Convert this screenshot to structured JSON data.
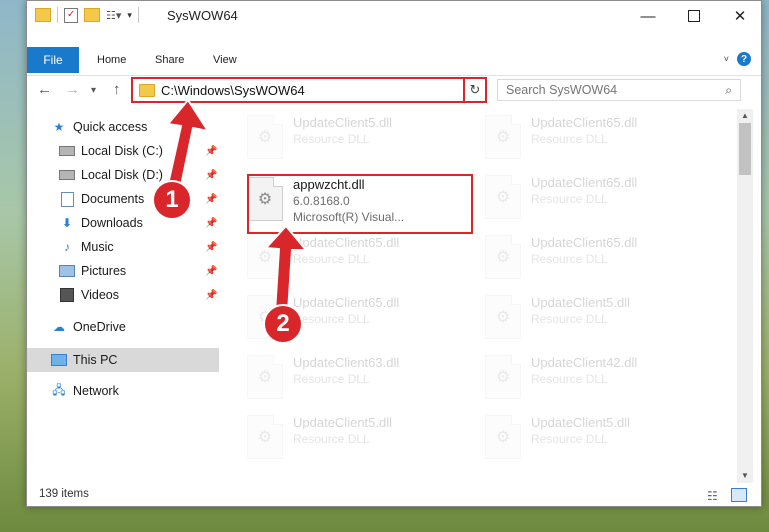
{
  "window": {
    "title": "SysWOW64"
  },
  "ribbon": {
    "file": "File",
    "home": "Home",
    "share": "Share",
    "view": "View"
  },
  "address": {
    "path": "C:\\Windows\\SysWOW64"
  },
  "search": {
    "placeholder": "Search SysWOW64"
  },
  "sidebar": {
    "items": [
      {
        "label": "Quick access"
      },
      {
        "label": "Local Disk (C:)"
      },
      {
        "label": "Local Disk (D:)"
      },
      {
        "label": "Documents"
      },
      {
        "label": "Downloads"
      },
      {
        "label": "Music"
      },
      {
        "label": "Pictures"
      },
      {
        "label": "Videos"
      },
      {
        "label": "OneDrive"
      },
      {
        "label": "This PC"
      },
      {
        "label": "Network"
      }
    ]
  },
  "files": [
    {
      "name": "UpdateClient5.dll",
      "desc": "Resource DLL"
    },
    {
      "name": "UpdateClient65.dll",
      "desc": "Resource DLL"
    },
    {
      "name": "appwzcht.dll",
      "version": "6.0.8168.0",
      "desc": "Microsoft(R) Visual..."
    },
    {
      "name": "UpdateClient65.dll",
      "desc": "Resource DLL"
    },
    {
      "name": "UpdateClient65.dll",
      "desc": "Resource DLL"
    },
    {
      "name": "UpdateClient65.dll",
      "desc": "Resource DLL"
    },
    {
      "name": "UpdateClient65.dll",
      "desc": "Resource DLL"
    },
    {
      "name": "UpdateClient5.dll",
      "desc": "Resource DLL"
    },
    {
      "name": "UpdateClient63.dll",
      "desc": "Resource DLL"
    },
    {
      "name": "UpdateClient42.dll",
      "desc": "Resource DLL"
    },
    {
      "name": "UpdateClient5.dll",
      "desc": "Resource DLL"
    },
    {
      "name": "UpdateClient5.dll",
      "desc": "Resource DLL"
    }
  ],
  "status": {
    "count": "139 items"
  },
  "annotations": {
    "step1": "1",
    "step2": "2"
  },
  "colors": {
    "accent": "#1979ca",
    "highlight": "#d9262b"
  }
}
